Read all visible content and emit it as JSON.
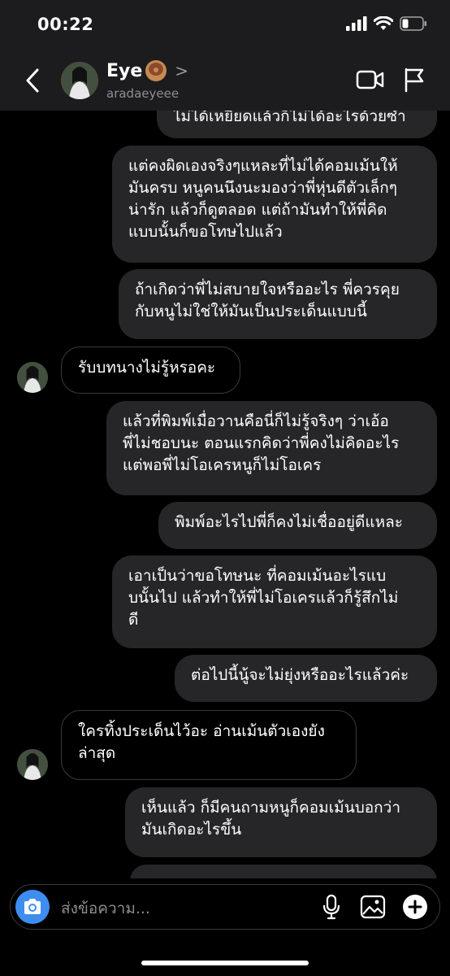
{
  "status": {
    "time": "00:22"
  },
  "header": {
    "name": "Eye",
    "chevron": ">",
    "username": "aradaeyeee"
  },
  "messages": [
    {
      "dir": "out",
      "text": "ไม่ได้เหยียดแล้วก็ไม่ได้อะไรด้วยซ้ำ"
    },
    {
      "dir": "out",
      "text": "แต่คงผิดเองจริงๆแหละที่ไม่ได้คอมเม้นให้\nมันครบ หนูคนนึงนะมองว่าพี่หุ่นดีตัวเล็กๆ\nน่ารัก แล้วก็ดูตลอด แต่ถ้ามันทำให้พี่คิด\nแบบนั้นก็ขอโทษไปแล้ว"
    },
    {
      "dir": "out",
      "text": "ถ้าเกิดว่าพี่ไม่สบายใจหรืออะไร พี่ควรคุย\nกับหนูไม่ใช่ให้มันเป็นประเด็นแบบนี้"
    },
    {
      "dir": "in",
      "text": "รับบทนางไม่รู้หรอคะ"
    },
    {
      "dir": "out",
      "text": "แล้วที่พิมพ์เมื่อวานคือนี่ก็ไม่รู้จริงๆ ว่าเอ้อ\nพี่ไม่ชอบนะ ตอนแรกคิดว่าพี่คงไม่คิดอะไร\nแต่พอพี่ไม่โอเครหนูก็ไม่โอเคร"
    },
    {
      "dir": "out",
      "text": "พิมพ์อะไรไปพี่ก็คงไม่เชื่ออยู่ดีแหละ"
    },
    {
      "dir": "out",
      "text": "เอาเป็นว่าขอโทษนะ ที่คอมเม้นอะไรแบ\nบนั้นไป แล้วทำให้พี่ไม่โอเครแล้วก็รู้สึกไม่\nดี"
    },
    {
      "dir": "out",
      "text": "ต่อไปนี้นู้จะไม่ยุ่งหรืออะไรแล้วค่ะ"
    },
    {
      "dir": "in",
      "text": "ใครทิ้งประเด็นไว้อะ อ่านเม้นตัวเองยัง\nล่าสุด"
    },
    {
      "dir": "out",
      "text": "เห็นแล้ว ก็มีคนถามหนูก็คอมเม้นบอกว่า\nมันเกิดอะไรขึ้น"
    },
    {
      "dir": "out",
      "text": ""
    }
  ],
  "composer": {
    "placeholder": "ส่งข้อความ..."
  },
  "icons": {
    "back": "chevron-left-icon",
    "video": "video-call-icon",
    "flag": "flag-icon",
    "camera": "camera-icon",
    "mic": "microphone-icon",
    "gallery": "gallery-icon",
    "plus": "plus-icon"
  },
  "colors": {
    "bubble_out": "#262628",
    "accent": "#3d8ef0",
    "background": "#000000"
  }
}
